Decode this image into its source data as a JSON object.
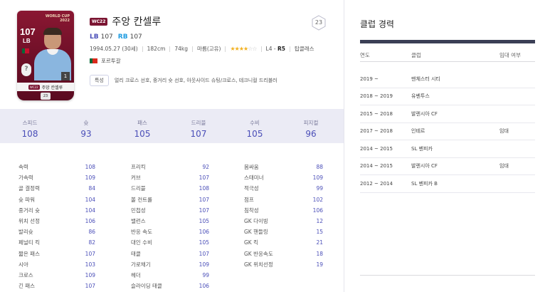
{
  "card": {
    "event_lines": [
      "WORLD CUP",
      "2022"
    ],
    "ovr": "107",
    "position": "LB",
    "rank_mark": "?",
    "number": "1",
    "season_mini": "WC22",
    "name": "주앙 칸셀루",
    "level": "23"
  },
  "player": {
    "season_badge": "WC22",
    "name": "주앙 칸셀루",
    "level": "23",
    "positions": [
      {
        "pos": "LB",
        "value": "107"
      },
      {
        "pos": "RB",
        "value": "107"
      }
    ],
    "birth": "1994.05.27 (30세)",
    "height": "182cm",
    "weight": "74kg",
    "body_type": "마름(고유)",
    "skill_moves": 4,
    "skill_moves_max": 6,
    "weak_foot_prefix": "L4 - ",
    "weak_foot_value": "R5",
    "extra_trait": "탑클래스",
    "nation": "포르투갈",
    "trait_label": "특성",
    "traits": "얼리 크로스 선호, 중거리 슛 선호, 아웃사이드 슈팅/크로스, 테크니컬 드리블러"
  },
  "summary": [
    {
      "label": "스피드",
      "value": "108"
    },
    {
      "label": "슛",
      "value": "93"
    },
    {
      "label": "패스",
      "value": "105"
    },
    {
      "label": "드리블",
      "value": "107"
    },
    {
      "label": "수비",
      "value": "105"
    },
    {
      "label": "피지컬",
      "value": "96"
    }
  ],
  "stats": {
    "col1": [
      {
        "label": "속력",
        "value": "108"
      },
      {
        "label": "가속력",
        "value": "109"
      },
      {
        "label": "골 결정력",
        "value": "84"
      },
      {
        "label": "슛 파워",
        "value": "104"
      },
      {
        "label": "중거리 슛",
        "value": "104"
      },
      {
        "label": "위치 선정",
        "value": "106"
      },
      {
        "label": "발리슛",
        "value": "86"
      },
      {
        "label": "페널티 킥",
        "value": "82"
      },
      {
        "label": "짧은 패스",
        "value": "107"
      },
      {
        "label": "시야",
        "value": "103"
      },
      {
        "label": "크로스",
        "value": "109"
      },
      {
        "label": "긴 패스",
        "value": "107"
      }
    ],
    "col2": [
      {
        "label": "프리킥",
        "value": "92"
      },
      {
        "label": "커브",
        "value": "107"
      },
      {
        "label": "드리블",
        "value": "108"
      },
      {
        "label": "볼 컨트롤",
        "value": "107"
      },
      {
        "label": "민첩성",
        "value": "107"
      },
      {
        "label": "밸런스",
        "value": "105"
      },
      {
        "label": "반응 속도",
        "value": "106"
      },
      {
        "label": "대인 수비",
        "value": "105"
      },
      {
        "label": "태클",
        "value": "107"
      },
      {
        "label": "가로채기",
        "value": "109"
      },
      {
        "label": "헤더",
        "value": "99"
      },
      {
        "label": "슬라이딩 태클",
        "value": "106"
      }
    ],
    "col3": [
      {
        "label": "몸싸움",
        "value": "88"
      },
      {
        "label": "스태미너",
        "value": "109"
      },
      {
        "label": "적극성",
        "value": "99"
      },
      {
        "label": "점프",
        "value": "102"
      },
      {
        "label": "침착성",
        "value": "106"
      },
      {
        "label": "GK 다이빙",
        "value": "12"
      },
      {
        "label": "GK 핸들링",
        "value": "15"
      },
      {
        "label": "GK 킥",
        "value": "21"
      },
      {
        "label": "GK 반응속도",
        "value": "18"
      },
      {
        "label": "GK 위치선정",
        "value": "19"
      }
    ]
  },
  "career": {
    "title": "클럽 경력",
    "headers": {
      "year": "연도",
      "club": "클럽",
      "loan": "임대 여부"
    },
    "rows": [
      {
        "year": "2019 ~",
        "club": "맨체스터 시티",
        "loan": ""
      },
      {
        "year": "2018 ~ 2019",
        "club": "유벤투스",
        "loan": ""
      },
      {
        "year": "2015 ~ 2018",
        "club": "발렌시아 CF",
        "loan": ""
      },
      {
        "year": "2017 ~ 2018",
        "club": "인테르",
        "loan": "임대"
      },
      {
        "year": "2014 ~ 2015",
        "club": "SL 벤피카",
        "loan": ""
      },
      {
        "year": "2014 ~ 2015",
        "club": "발렌시아 CF",
        "loan": "임대"
      },
      {
        "year": "2012 ~ 2014",
        "club": "SL 벤피카 B",
        "loan": ""
      }
    ]
  },
  "colors": {
    "accent": "#4a4eb8",
    "accent_light": "#1d9be0",
    "season": "#7b1532",
    "star": "#f2b01e",
    "summary_bg": "#ebebf5",
    "rule": "#3b3f55"
  }
}
